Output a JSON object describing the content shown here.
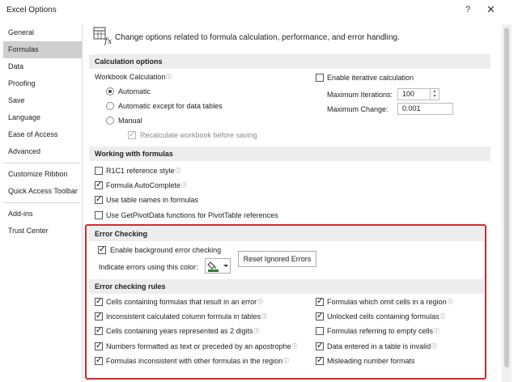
{
  "window": {
    "title": "Excel Options",
    "help": "?",
    "close": "✕"
  },
  "sidebar": {
    "groups": [
      [
        "General",
        "Formulas",
        "Data",
        "Proofing",
        "Save",
        "Language",
        "Ease of Access",
        "Advanced"
      ],
      [
        "Customize Ribbon",
        "Quick Access Toolbar"
      ],
      [
        "Add-ins",
        "Trust Center"
      ]
    ],
    "selected": "Formulas"
  },
  "header": {
    "text": "Change options related to formula calculation, performance, and error handling."
  },
  "calculation": {
    "title": "Calculation options",
    "workbook_label": "Workbook Calculation",
    "radios": [
      {
        "label": "Automatic",
        "checked": true
      },
      {
        "label": "Automatic except for data tables",
        "checked": false
      },
      {
        "label": "Manual",
        "checked": false
      }
    ],
    "recalc_label": "Recalculate workbook before saving",
    "iterative_label": "Enable iterative calculation",
    "max_iter_label": "Maximum Iterations:",
    "max_iter_value": "100",
    "max_change_label": "Maximum Change:",
    "max_change_value": "0.001"
  },
  "formulas": {
    "title": "Working with formulas",
    "items": [
      {
        "label": "R1C1 reference style",
        "checked": false,
        "info": true
      },
      {
        "label": "Formula AutoComplete",
        "checked": true,
        "info": true
      },
      {
        "label": "Use table names in formulas",
        "checked": true,
        "info": false
      },
      {
        "label": "Use GetPivotData functions for PivotTable references",
        "checked": false,
        "info": false
      }
    ]
  },
  "error_checking": {
    "title": "Error Checking",
    "enable_label": "Enable background error checking",
    "enable_checked": true,
    "indicate_label": "Indicate errors using this color:",
    "reset_label": "Reset Ignored Errors",
    "indicator_color": "#2e7d32"
  },
  "rules": {
    "title": "Error checking rules",
    "left": [
      {
        "label": "Cells containing formulas that result in an error",
        "checked": true
      },
      {
        "label": "Inconsistent calculated column formula in tables",
        "checked": true
      },
      {
        "label": "Cells containing years represented as 2 digits",
        "checked": true
      },
      {
        "label": "Numbers formatted as text or preceded by an apostrophe",
        "checked": true
      },
      {
        "label": "Formulas inconsistent with other formulas in the region",
        "checked": true
      }
    ],
    "right": [
      {
        "label": "Formulas which omit cells in a region",
        "checked": true
      },
      {
        "label": "Unlocked cells containing formulas",
        "checked": true
      },
      {
        "label": "Formulas referring to empty cells",
        "checked": false
      },
      {
        "label": "Data entered in a table is invalid",
        "checked": true
      },
      {
        "label": "Misleading number formats",
        "checked": true
      }
    ]
  },
  "info_glyph": "ⓘ",
  "highlight_color": "#d8262c"
}
